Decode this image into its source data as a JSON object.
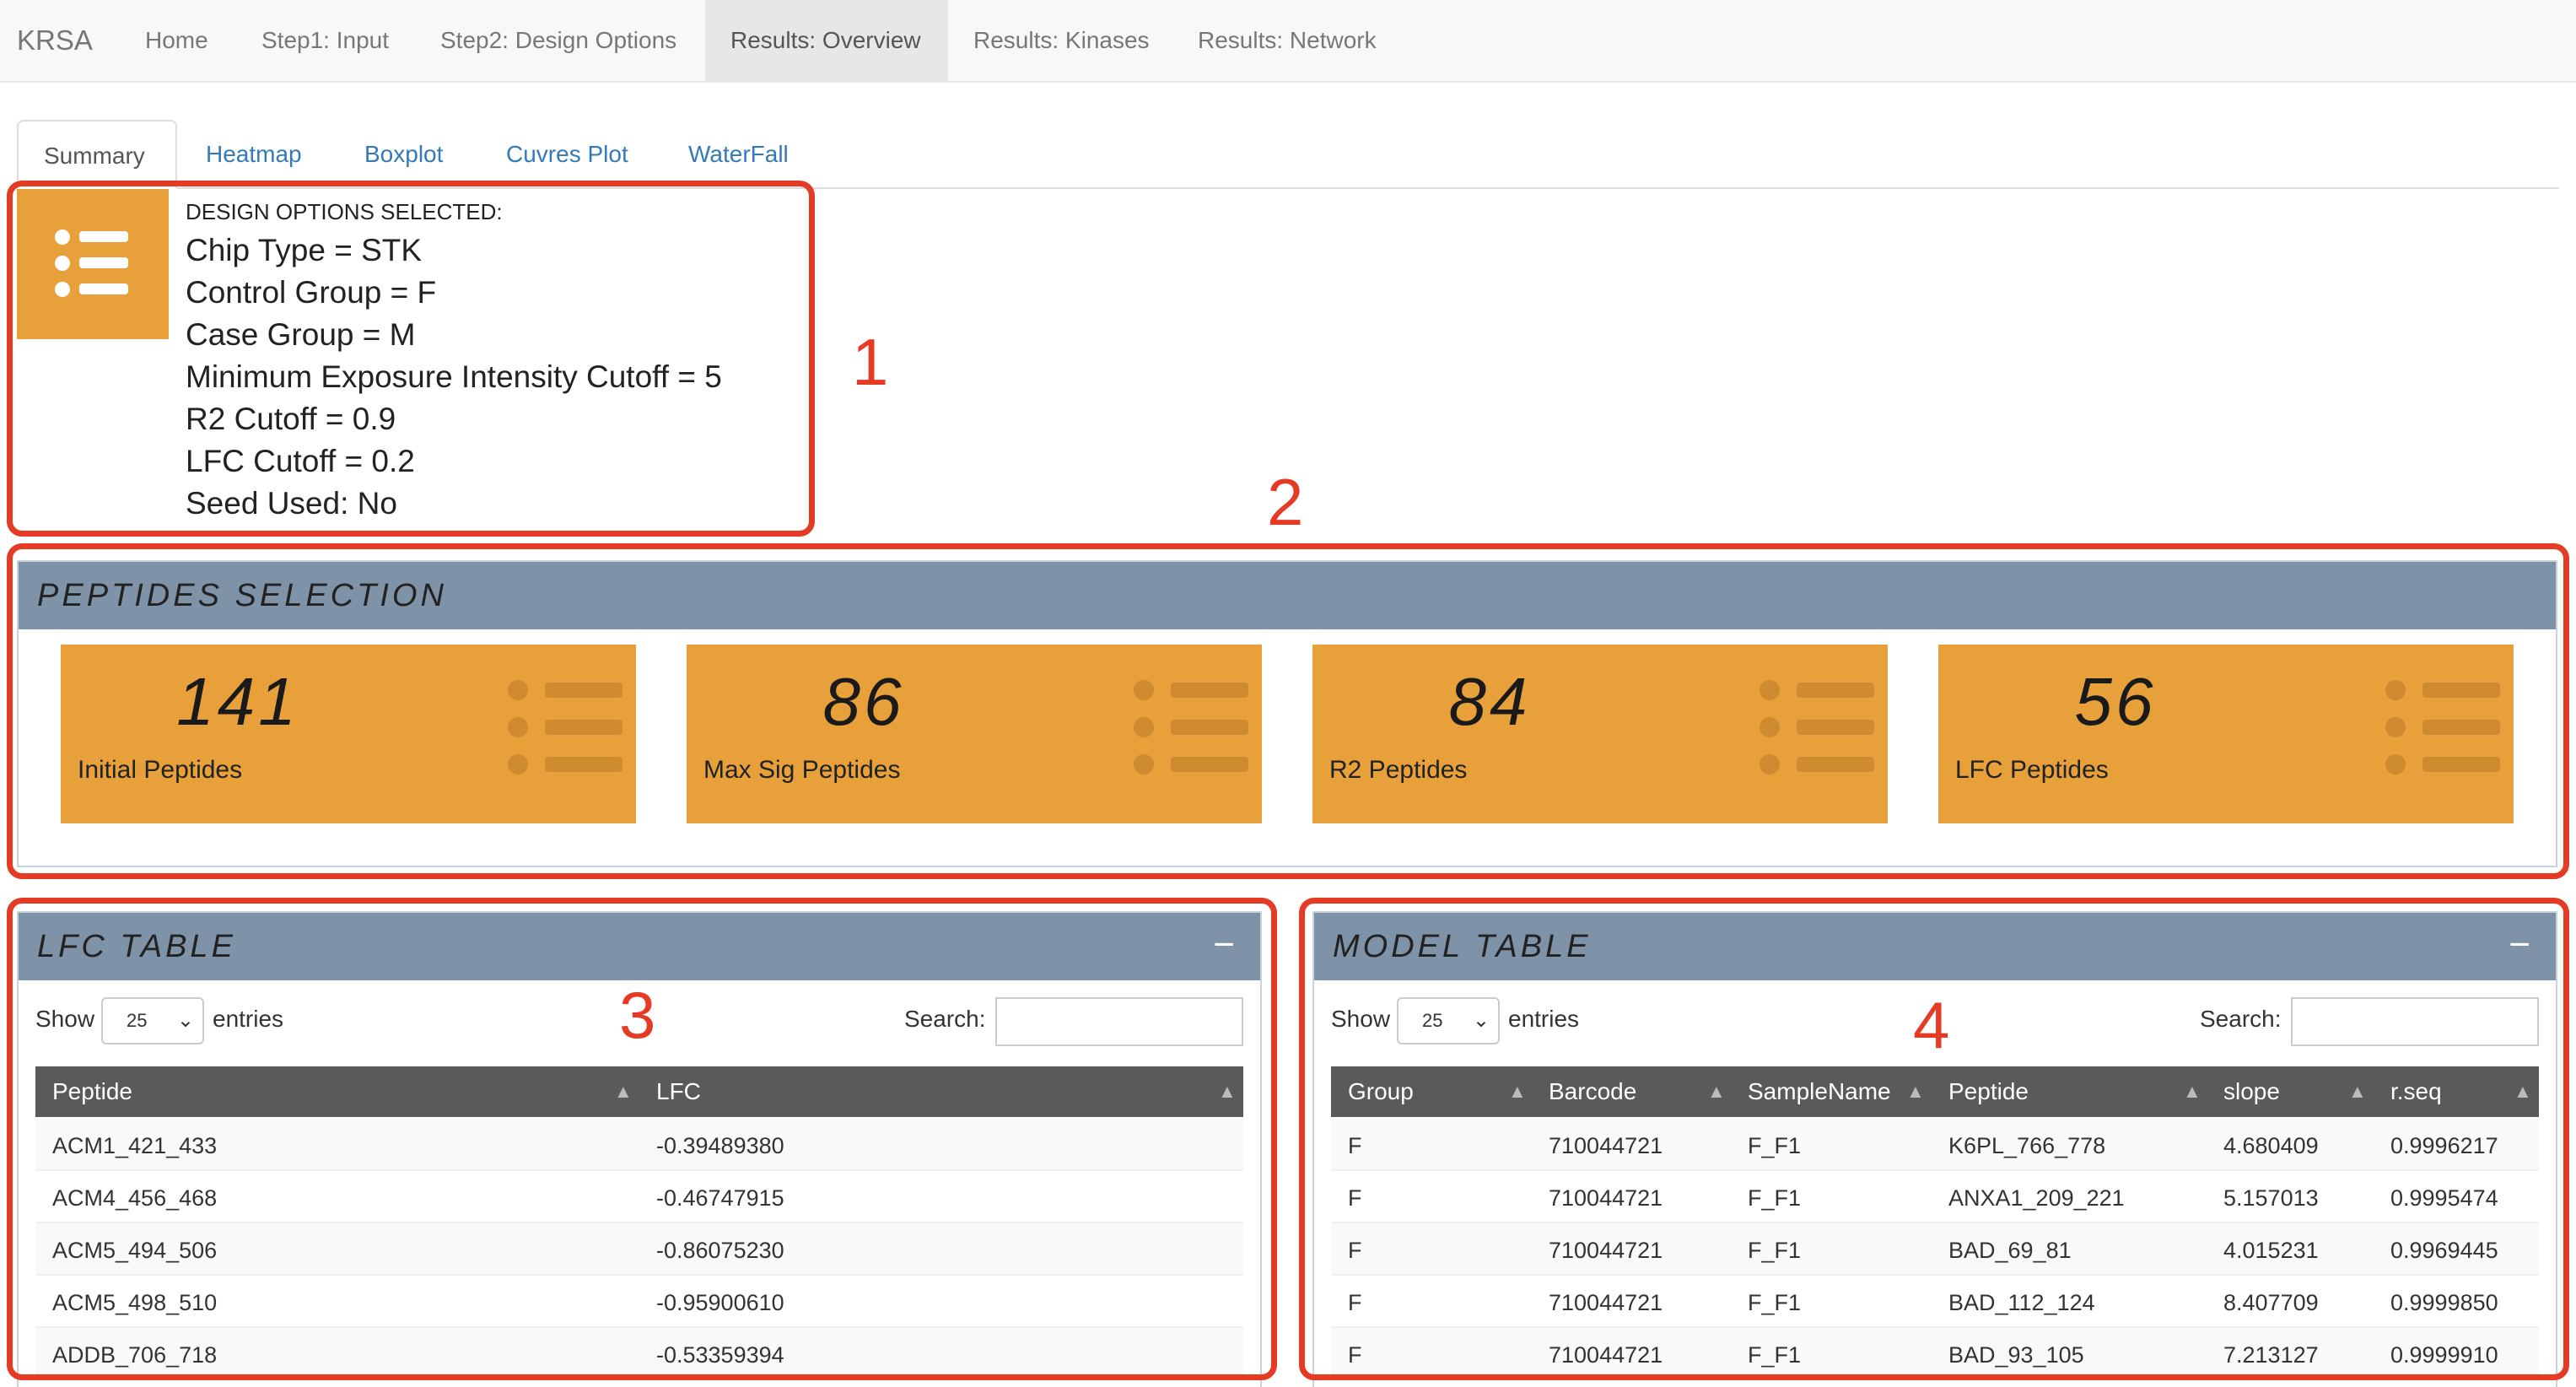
{
  "navbar": {
    "brand": "KRSA",
    "items": [
      {
        "label": "Home",
        "active": false
      },
      {
        "label": "Step1: Input",
        "active": false
      },
      {
        "label": "Step2: Design Options",
        "active": false
      },
      {
        "label": "Results: Overview",
        "active": true
      },
      {
        "label": "Results: Kinases",
        "active": false
      },
      {
        "label": "Results: Network",
        "active": false
      }
    ]
  },
  "tabs": [
    {
      "label": "Summary",
      "active": true
    },
    {
      "label": "Heatmap",
      "active": false
    },
    {
      "label": "Boxplot",
      "active": false
    },
    {
      "label": "Cuvres Plot",
      "active": false
    },
    {
      "label": "WaterFall",
      "active": false
    }
  ],
  "design_options": {
    "icon": "list-icon",
    "heading": "DESIGN OPTIONS SELECTED:",
    "lines": [
      "Chip Type = STK",
      "Control Group = F",
      "Case Group = M",
      "Minimum Exposure Intensity Cutoff = 5",
      "R2 Cutoff = 0.9",
      "LFC Cutoff = 0.2",
      "Seed Used: No"
    ]
  },
  "peptides_selection": {
    "title": "PEPTIDES SELECTION",
    "stats": [
      {
        "value": "141",
        "label": "Initial Peptides",
        "icon": "list-icon"
      },
      {
        "value": "86",
        "label": "Max Sig Peptides",
        "icon": "list-icon"
      },
      {
        "value": "84",
        "label": "R2 Peptides",
        "icon": "list-icon"
      },
      {
        "value": "56",
        "label": "LFC Peptides",
        "icon": "list-icon"
      }
    ]
  },
  "lfc_table": {
    "title": "LFC TABLE",
    "collapse": "−",
    "show_label": "Show",
    "entries_value": "25",
    "entries_label": "entries",
    "search_label": "Search:",
    "search_value": "",
    "columns": [
      "Peptide",
      "LFC"
    ],
    "rows": [
      [
        "ACM1_421_433",
        "-0.39489380"
      ],
      [
        "ACM4_456_468",
        "-0.46747915"
      ],
      [
        "ACM5_494_506",
        "-0.86075230"
      ],
      [
        "ACM5_498_510",
        "-0.95900610"
      ],
      [
        "ADDB_706_718",
        "-0.53359394"
      ]
    ]
  },
  "model_table": {
    "title": "MODEL TABLE",
    "collapse": "−",
    "show_label": "Show",
    "entries_value": "25",
    "entries_label": "entries",
    "search_label": "Search:",
    "search_value": "",
    "columns": [
      "Group",
      "Barcode",
      "SampleName",
      "Peptide",
      "slope",
      "r.seq"
    ],
    "rows": [
      [
        "F",
        "710044721",
        "F_F1",
        "K6PL_766_778",
        "4.680409",
        "0.9996217"
      ],
      [
        "F",
        "710044721",
        "F_F1",
        "ANXA1_209_221",
        "5.157013",
        "0.9995474"
      ],
      [
        "F",
        "710044721",
        "F_F1",
        "BAD_69_81",
        "4.015231",
        "0.9969445"
      ],
      [
        "F",
        "710044721",
        "F_F1",
        "BAD_112_124",
        "8.407709",
        "0.9999850"
      ],
      [
        "F",
        "710044721",
        "F_F1",
        "BAD_93_105",
        "7.213127",
        "0.9999910"
      ]
    ]
  },
  "annotations": [
    "1",
    "2",
    "3",
    "4"
  ],
  "colors": {
    "accent_orange": "#e8a03b",
    "box_header": "#7e93a8",
    "annotation_red": "#e53a24",
    "table_header": "#5a5a5a"
  }
}
